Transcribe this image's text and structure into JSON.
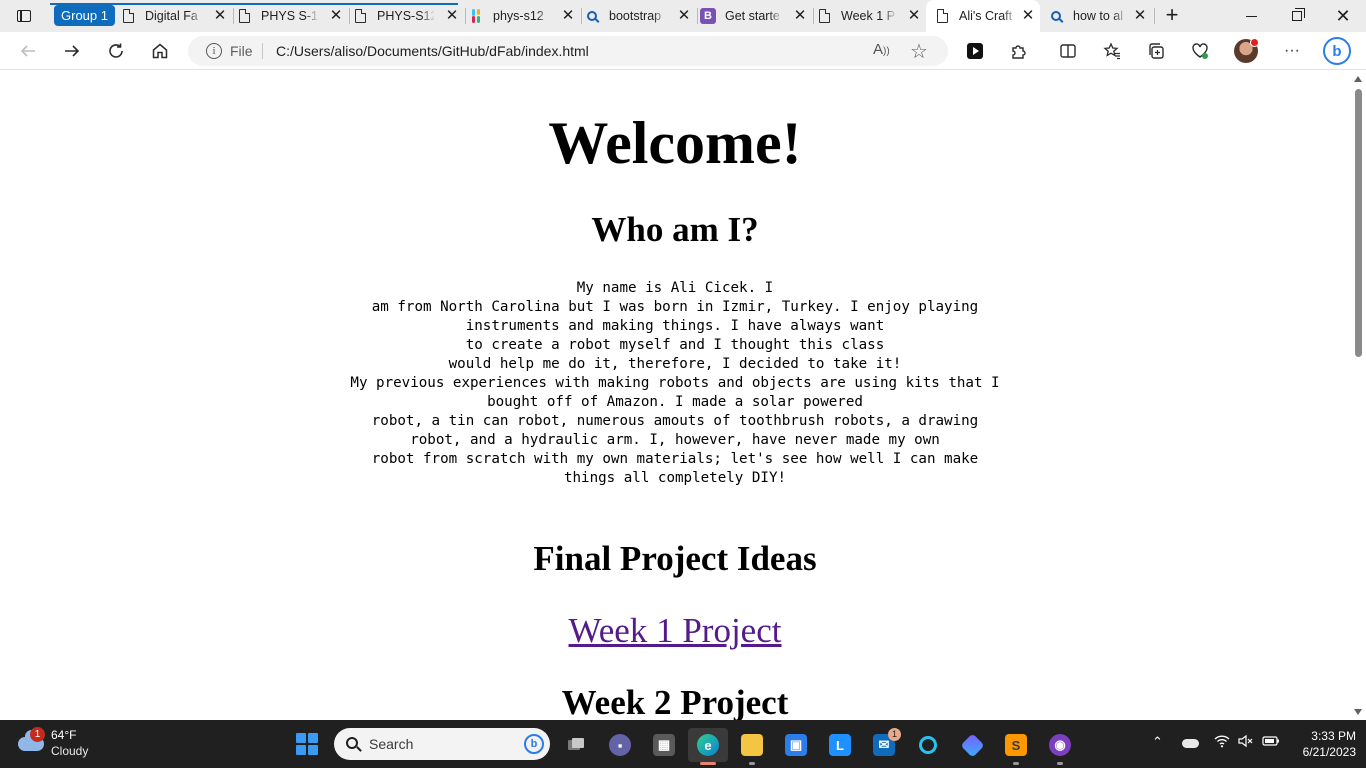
{
  "browser": {
    "tab_group_label": "Group 1",
    "tabs": [
      {
        "title": "Digital Fa",
        "icon": "document-icon"
      },
      {
        "title": "PHYS S-1",
        "icon": "document-icon"
      },
      {
        "title": "PHYS-S12",
        "icon": "document-icon"
      },
      {
        "title": "phys-s12",
        "icon": "slack-icon"
      },
      {
        "title": "bootstrap",
        "icon": "search-icon"
      },
      {
        "title": "Get starte",
        "icon": "bootstrap-icon"
      },
      {
        "title": "Week 1 P",
        "icon": "document-icon"
      },
      {
        "title": "Ali's Craft",
        "icon": "document-icon",
        "active": true
      },
      {
        "title": "how to al",
        "icon": "search-icon"
      }
    ],
    "close_glyph": "✕",
    "new_tab_glyph": "+",
    "omnibox": {
      "scheme_label": "File",
      "url": "C:/Users/aliso/Documents/GitHub/dFab/index.html"
    }
  },
  "page": {
    "heading": "Welcome!",
    "about_heading": "Who am I?",
    "about_lines": [
      "My name is Ali Cicek. I",
      "am from North Carolina but I was born in Izmir, Turkey. I enjoy playing",
      "instruments and making things. I have always want",
      "to create a robot myself and I thought this class",
      "would help me do it, therefore, I decided to take it!",
      "My previous experiences with making robots and objects are using kits that I",
      "bought off of Amazon. I made a solar powered",
      "robot, a tin can robot, numerous amouts of toothbrush robots, a drawing",
      "robot, and a hydraulic arm. I, however, have never made my own",
      "robot from scratch with my own materials; let's see how well I can make",
      "things all completely DIY!"
    ],
    "projects_heading": "Final Project Ideas",
    "week1_link": "Week 1 Project",
    "week2_heading": "Week 2 Project"
  },
  "taskbar": {
    "weather": {
      "badge": "1",
      "temp": "64°F",
      "condition": "Cloudy"
    },
    "search_placeholder": "Search",
    "mail_badge": "1",
    "clock": {
      "time": "3:33 PM",
      "date": "6/21/2023"
    }
  },
  "colors": {
    "tab_group": "#0f6cbd",
    "link_visited": "#551a8b",
    "taskbar": "#202020"
  }
}
